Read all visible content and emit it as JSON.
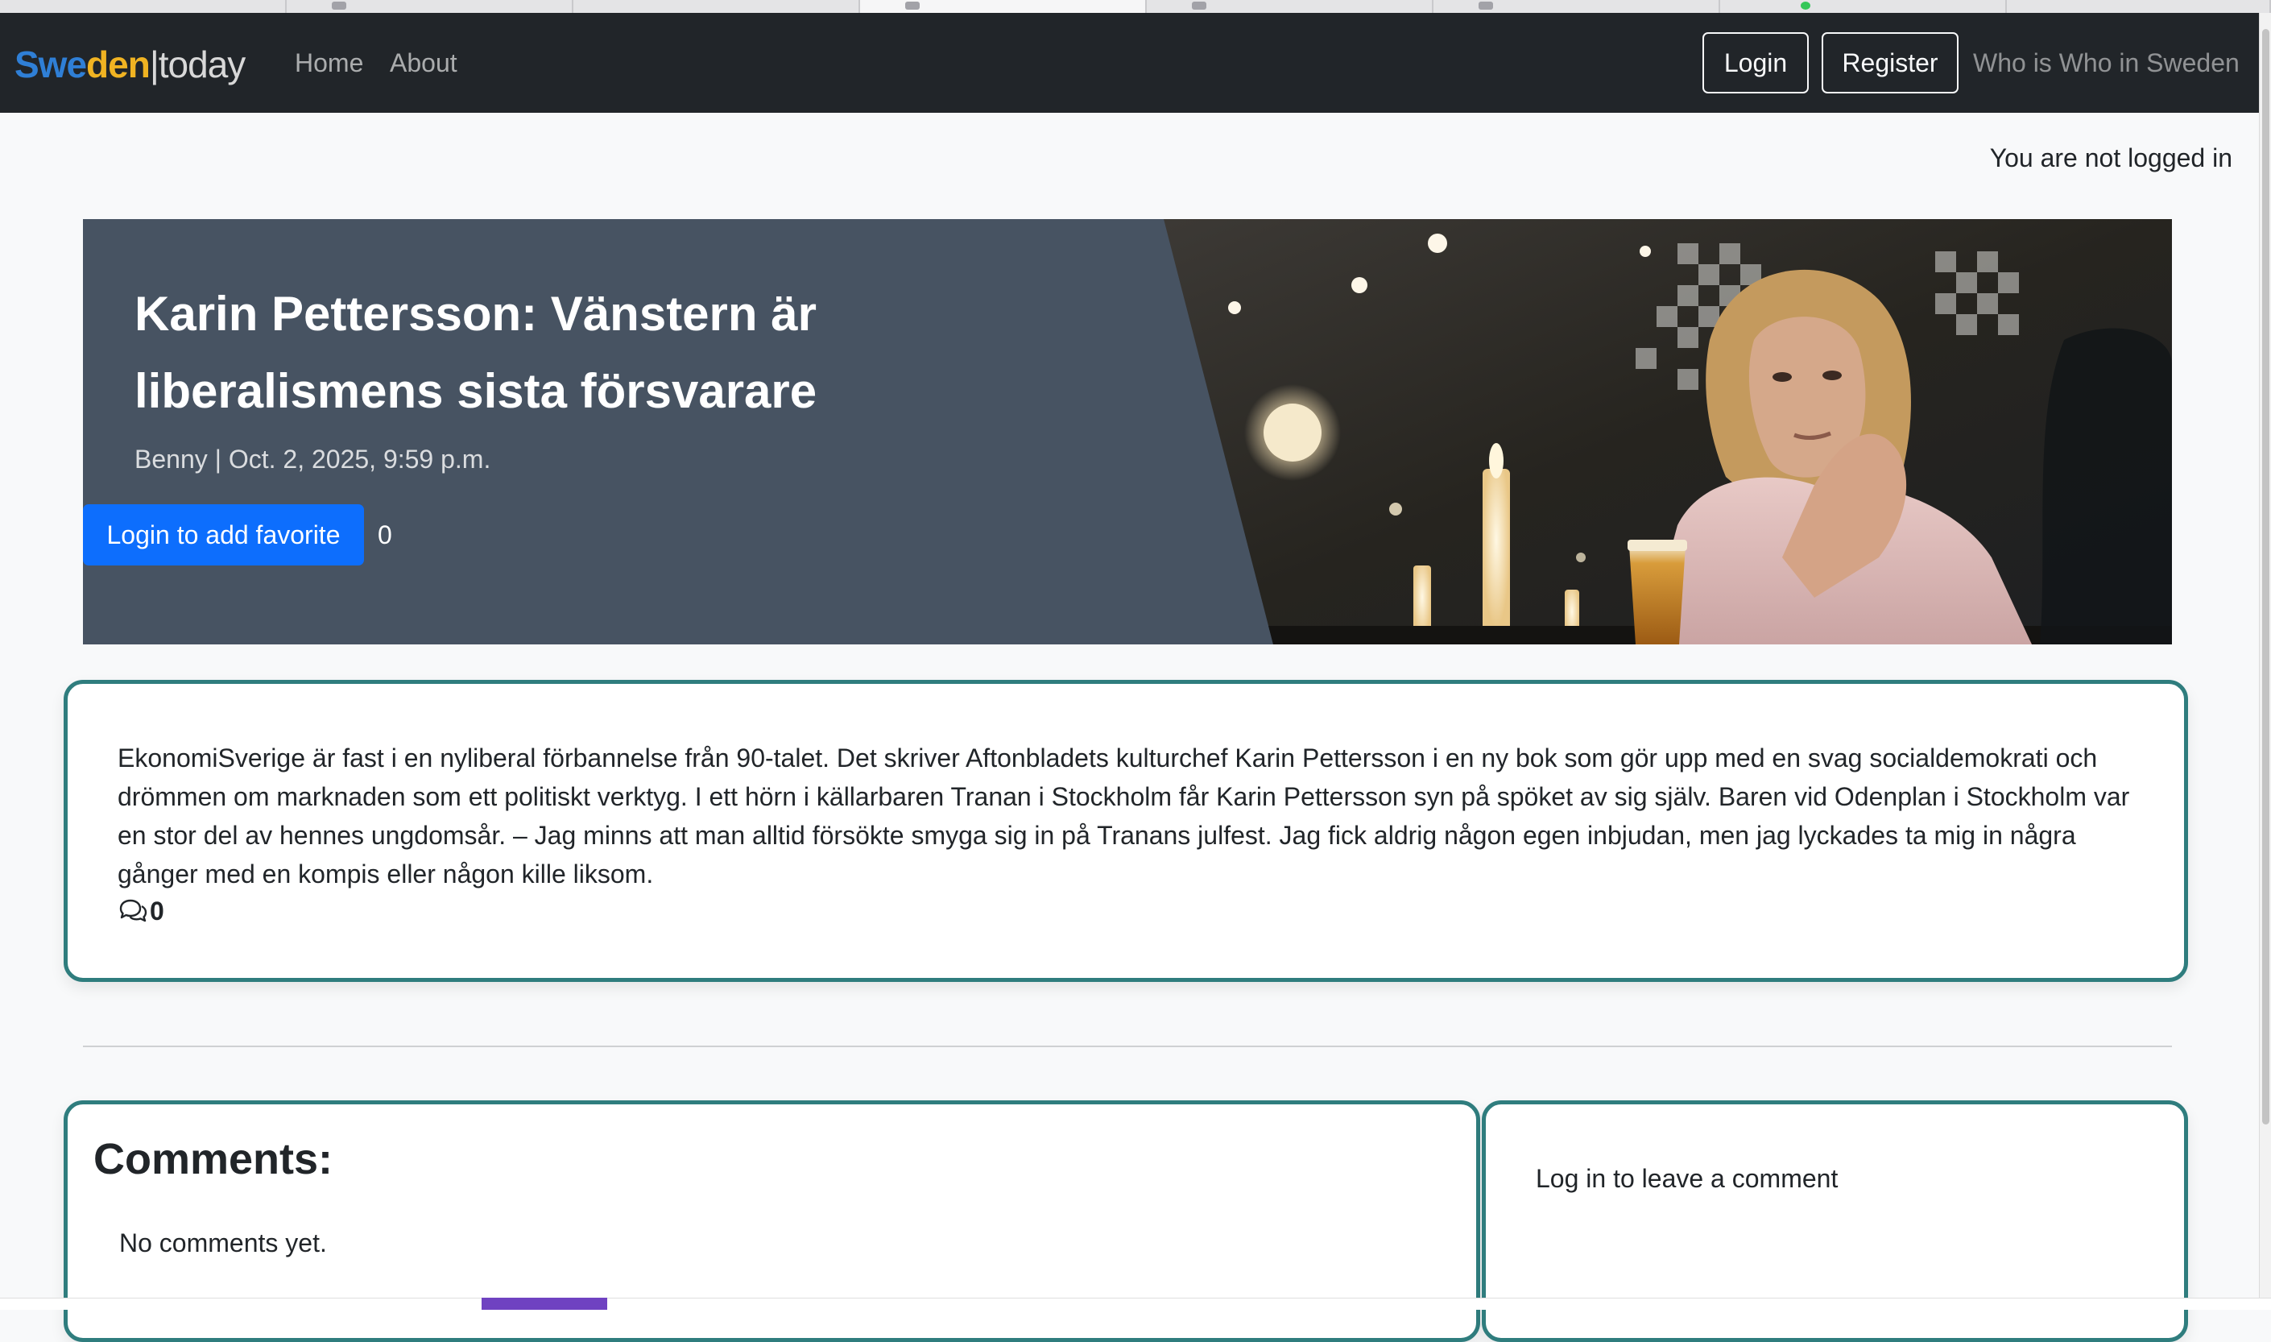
{
  "brand": {
    "part1": "Swe",
    "part2": "den",
    "separator": "|",
    "part3": "today"
  },
  "nav": {
    "home": "Home",
    "about": "About",
    "login": "Login",
    "register": "Register",
    "who": "Who is Who in Sweden"
  },
  "status": {
    "login_status": "You are not logged in"
  },
  "article": {
    "title": "Karin Pettersson: Vänstern är liberalismens sista försvarare",
    "meta": "Benny | Oct. 2, 2025, 9:59 p.m.",
    "favorite_button": "Login to add favorite",
    "favorite_count": "0",
    "body": "EkonomiSverige är fast i en nyliberal förbannelse från 90-talet. Det skriver Aftonbladets kulturchef Karin Pettersson i en ny bok som gör upp med en svag socialdemokrati och drömmen om marknaden som ett politiskt verktyg. I ett hörn i källarbaren Tranan i Stockholm får Karin Pettersson syn på spöket av sig själv. Baren vid Odenplan i Stockholm var en stor del av hennes ungdomsår. – Jag minns att man alltid försökte smyga sig in på Tranans julfest. Jag fick aldrig någon egen inbjudan, men jag lyckades ta mig in några gånger med en kompis eller någon kille liksom.",
    "comment_icon": "chat-bubbles-icon",
    "comment_count": "0"
  },
  "comments": {
    "title": "Comments:",
    "empty": "No comments yet.",
    "login_prompt": "Log in to leave a comment"
  },
  "colors": {
    "navbar": "#212529",
    "brand_blue": "#2f7fd6",
    "brand_yellow": "#f0b322",
    "hero_bg": "#475362",
    "primary_button": "#0d6efd",
    "card_border": "#2f7d7e"
  }
}
